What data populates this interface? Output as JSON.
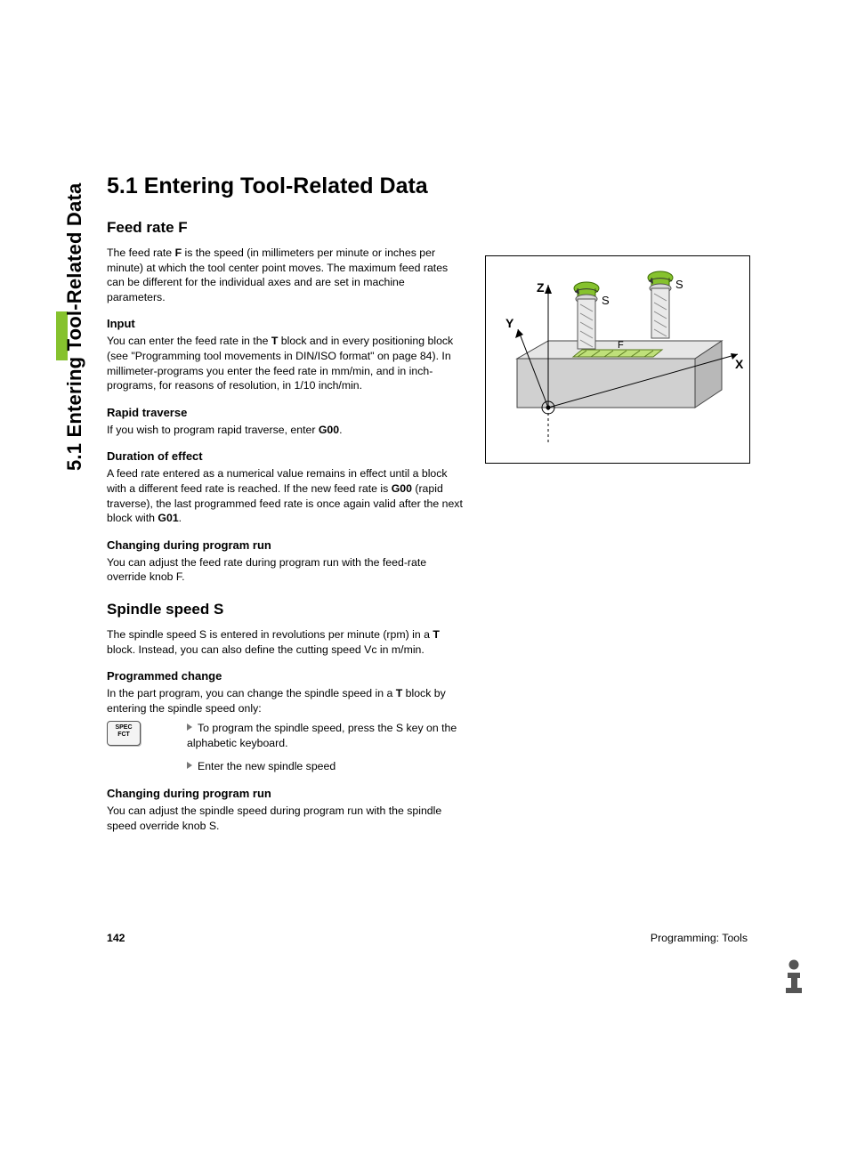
{
  "side_tab": "5.1 Entering Tool-Related Data",
  "title": "5.1  Entering Tool-Related Data",
  "feed": {
    "heading": "Feed rate F",
    "intro_a": "The feed rate ",
    "intro_bold": "F",
    "intro_b": " is the speed (in millimeters per minute or inches per minute) at which the tool center point moves. The maximum feed rates can be different for the individual axes and are set in machine parameters.",
    "input_head": "Input",
    "input_a": "You can enter the feed rate in the ",
    "input_bold": "T",
    "input_b": " block and in every positioning block (see \"Programming tool movements in DIN/ISO format\" on page 84). In millimeter-programs you enter the feed rate in mm/min, and in inch-programs, for reasons of resolution, in 1/10 inch/min.",
    "rapid_head": "Rapid traverse",
    "rapid_a": "If you wish to program rapid traverse, enter ",
    "rapid_bold": "G00",
    "rapid_b": ".",
    "duration_head": "Duration of effect",
    "duration_a": "A feed rate entered as a numerical value remains in effect until a block with a different feed rate is reached. If the new feed rate is ",
    "duration_bold1": "G00",
    "duration_mid": " (rapid traverse), the last programmed feed rate is once again valid after the next block with ",
    "duration_bold2": "G01",
    "duration_b": ".",
    "change_head": "Changing during program run",
    "change_body": "You can adjust the feed rate during program run with the feed-rate override knob F."
  },
  "spindle": {
    "heading": "Spindle speed S",
    "intro_a": "The spindle speed S is entered in revolutions per minute (rpm) in a ",
    "intro_bold": "T",
    "intro_b": " block. Instead, you can also define the cutting speed Vc in m/min.",
    "prog_head": "Programmed change",
    "prog_a": "In the part program, you can change the spindle speed in a ",
    "prog_bold": "T",
    "prog_b": " block by entering the spindle speed only:",
    "key_line1": "SPEC",
    "key_line2": "FCT",
    "step1": "To program the spindle speed, press the S key on the alphabetic keyboard.",
    "step2": "Enter the new spindle speed",
    "change_head": "Changing during program run",
    "change_body": "You can adjust the spindle speed during program run with the spindle speed override knob S."
  },
  "figure": {
    "Z": "Z",
    "Y": "Y",
    "X": "X",
    "S": "S",
    "F": "F"
  },
  "footer": {
    "page": "142",
    "chapter": "Programming: Tools"
  }
}
